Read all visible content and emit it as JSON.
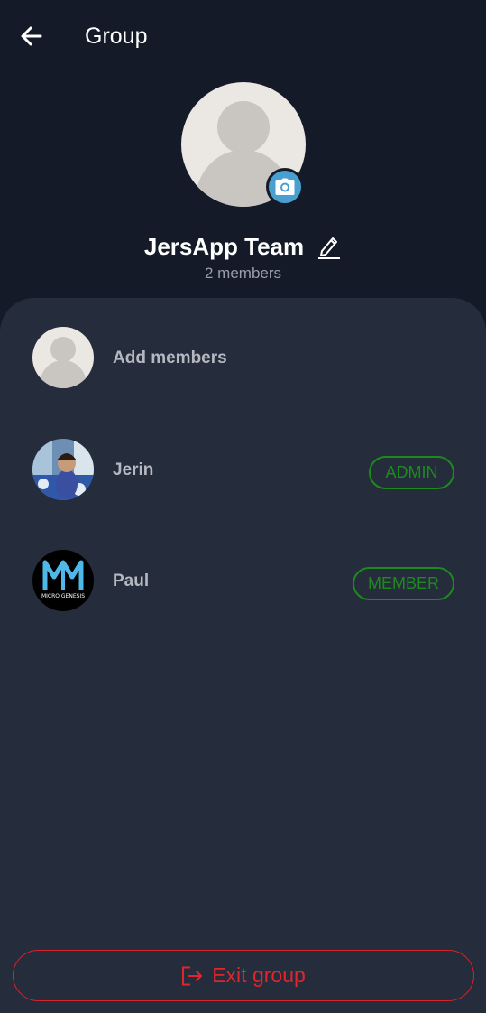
{
  "header": {
    "title": "Group"
  },
  "group": {
    "name": "JersApp Team",
    "member_count": "2 members"
  },
  "add_members": {
    "label": "Add members"
  },
  "members": [
    {
      "name": "Jerin",
      "role": "ADMIN"
    },
    {
      "name": "Paul",
      "role": "MEMBER",
      "logo_text": "MICRO GENESIS"
    }
  ],
  "footer": {
    "exit_label": "Exit group"
  },
  "colors": {
    "background": "#141a28",
    "panel": "#252c3c",
    "accent_camera": "#4a9fd1",
    "role_badge": "#1d8a1d",
    "danger": "#e0252c"
  },
  "icons": [
    "back-arrow-icon",
    "camera-icon",
    "pencil-icon",
    "exit-icon"
  ]
}
